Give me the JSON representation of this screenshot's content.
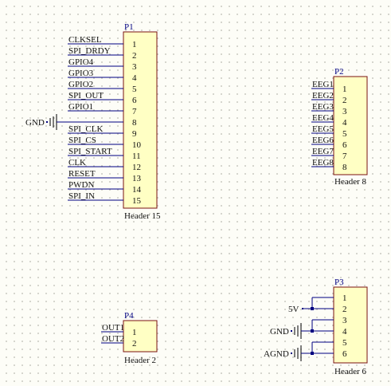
{
  "colors": {
    "background": "#fdfdf7",
    "component_fill": "#ffffc4",
    "component_border": "#7a1212",
    "wire": "#000080",
    "text": "#111111"
  },
  "p1": {
    "designator": "P1",
    "comment": "Header 15",
    "pins": [
      "1",
      "2",
      "3",
      "4",
      "5",
      "6",
      "7",
      "8",
      "9",
      "10",
      "11",
      "12",
      "13",
      "14",
      "15"
    ],
    "nets": [
      "CLKSEL",
      "SPI_DRDY",
      "GPIO4",
      "GPIO3",
      "GPIO2",
      "SPI_OUT",
      "GPIO1",
      "",
      "SPI_CLK",
      "SPI_CS",
      "SPI_START",
      "CLK",
      "RESET",
      "PWDN",
      "SPI_IN"
    ],
    "gnd_label": "GND"
  },
  "p2": {
    "designator": "P2",
    "comment": "Header 8",
    "pins": [
      "1",
      "2",
      "3",
      "4",
      "5",
      "6",
      "7",
      "8"
    ],
    "nets": [
      "EEG1",
      "EEG2",
      "EEG3",
      "EEG4",
      "EEG5",
      "EEG6",
      "EEG7",
      "EEG8"
    ]
  },
  "p3": {
    "designator": "P3",
    "comment": "Header 6",
    "pins": [
      "1",
      "2",
      "3",
      "4",
      "5",
      "6"
    ],
    "labels": {
      "v5": "5V",
      "gnd": "GND",
      "agnd": "AGND"
    }
  },
  "p4": {
    "designator": "P4",
    "comment": "Header 2",
    "pins": [
      "1",
      "2"
    ],
    "nets": [
      "OUT1",
      "OUT2"
    ]
  }
}
